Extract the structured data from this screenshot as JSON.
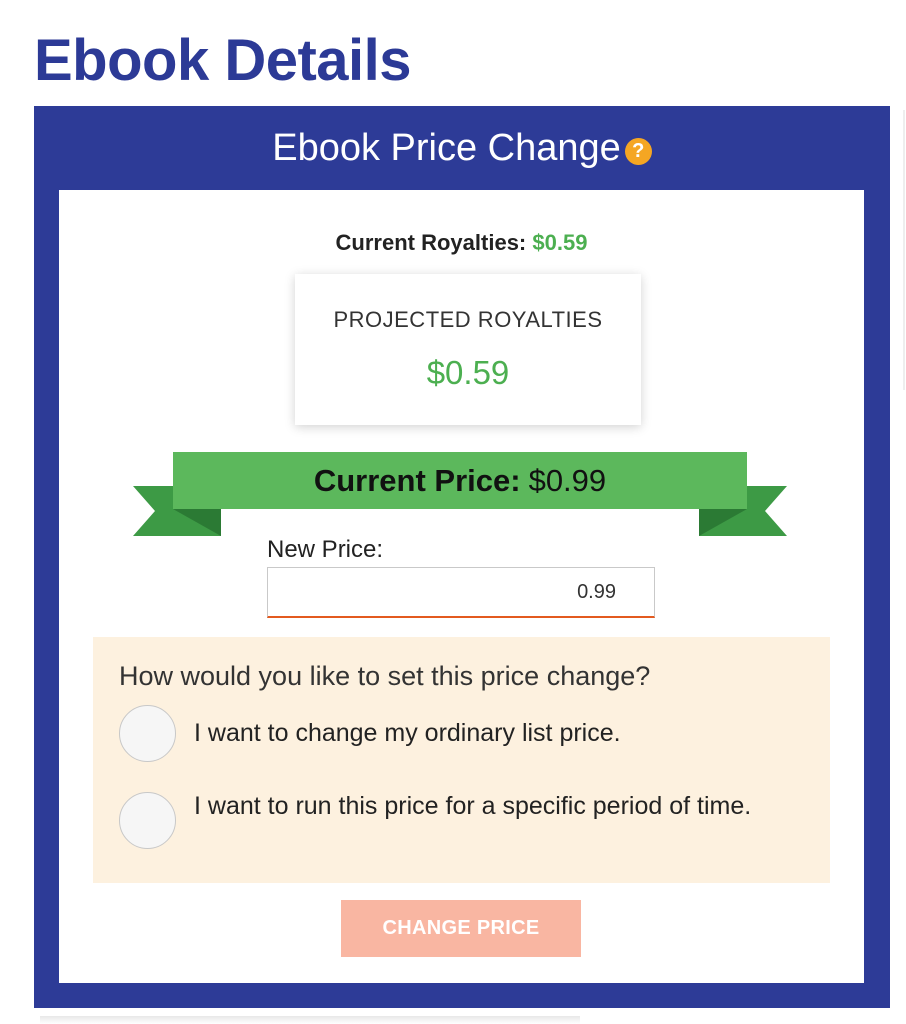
{
  "page": {
    "title": "Ebook Details"
  },
  "panel": {
    "title": "Ebook Price Change",
    "help_icon": "?"
  },
  "royalties": {
    "current_label": "Current Royalties:",
    "current_value": "$0.59",
    "projected_label": "PROJECTED ROYALTIES",
    "projected_value": "$0.59"
  },
  "price": {
    "current_label": "Current Price:",
    "current_value": "$0.99",
    "new_label": "New Price:",
    "new_value": "0.99"
  },
  "options": {
    "question": "How would you like to set this price change?",
    "items": [
      {
        "label": "I want to change my ordinary list price.",
        "selected": false
      },
      {
        "label": "I want to run this price for a specific period of time.",
        "selected": false
      }
    ]
  },
  "actions": {
    "change_price": "CHANGE PRICE"
  },
  "colors": {
    "brand_blue": "#2d3b97",
    "accent_green": "#4caf50",
    "ribbon_green": "#5cb85c",
    "help_orange": "#f5a623",
    "button_disabled": "#f9b6a2",
    "options_bg": "#fdf1df"
  }
}
